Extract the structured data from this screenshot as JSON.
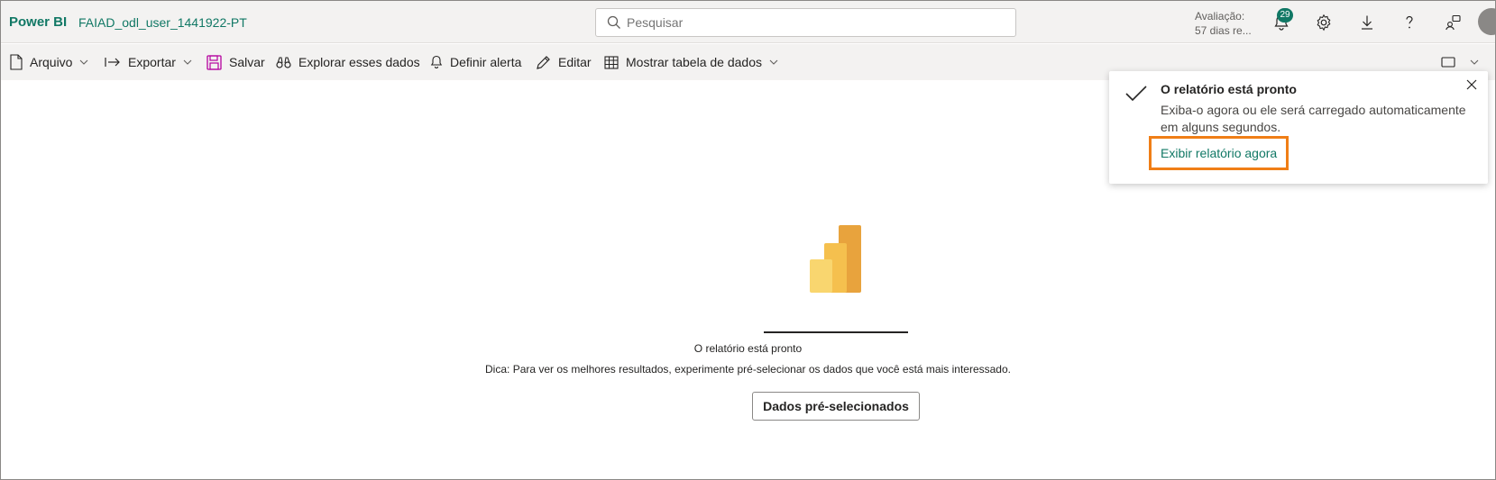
{
  "header": {
    "brand": "Power BI",
    "workspace": "FAIAD_odl_user_1441922-PT",
    "search_placeholder": "Pesquisar",
    "trial_line1": "Avaliação:",
    "trial_line2": "57 dias re...",
    "notification_count": "29",
    "icons": [
      "bell-icon",
      "gear-icon",
      "download-icon",
      "help-icon",
      "feedback-icon"
    ]
  },
  "toolbar": {
    "arquivo": "Arquivo",
    "exportar": "Exportar",
    "salvar": "Salvar",
    "explorar": "Explorar esses dados",
    "definir_alerta": "Definir alerta",
    "editar": "Editar",
    "mostrar_tabela": "Mostrar tabela de dados"
  },
  "toast": {
    "title": "O relatório está pronto",
    "message": "Exiba-o agora ou ele será carregado automaticamente em alguns segundos.",
    "link": "Exibir relatório agora"
  },
  "main": {
    "status": "O relatório está pronto",
    "tip": "Dica: Para ver os melhores resultados, experimente pré-selecionar os dados que você está mais interessado.",
    "button": "Dados pré-selecionados"
  },
  "colors": {
    "accent": "#117865",
    "highlight": "#f07e16",
    "logo_dark": "#e8a33d",
    "logo_light": "#f9d66f"
  }
}
